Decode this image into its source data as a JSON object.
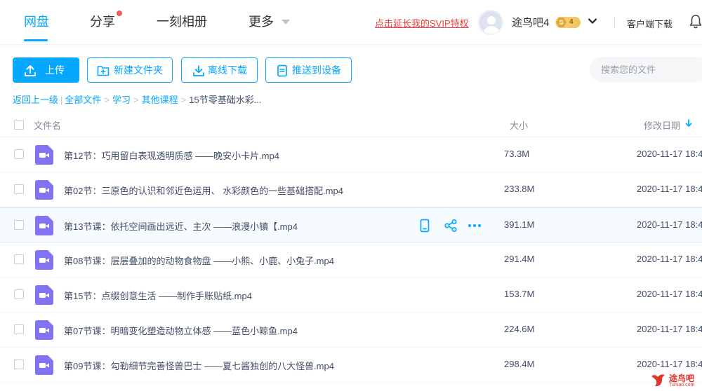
{
  "nav": {
    "tabs": [
      {
        "label": "网盘",
        "active": true
      },
      {
        "label": "分享",
        "badge_dot": true
      },
      {
        "label": "一刻相册"
      },
      {
        "label": "更多"
      }
    ],
    "promo_link": "点击延长我的SVIP特权",
    "username": "途鸟吧4",
    "vip_badge": {
      "tier": "S",
      "level": "4"
    },
    "client_download": "客户端下载"
  },
  "toolbar": {
    "upload": "上传",
    "new_folder": "新建文件夹",
    "offline_download": "离线下载",
    "push_to_device": "推送到设备",
    "search_placeholder": "搜索您的文件"
  },
  "breadcrumb": {
    "back": "返回上一级",
    "items": [
      "全部文件",
      "学习",
      "其他课程"
    ],
    "current": "15节零基础水彩..."
  },
  "table": {
    "headers": {
      "name": "文件名",
      "size": "大小",
      "modified": "修改日期"
    },
    "sort": {
      "column": "modified",
      "direction": "desc"
    },
    "rows": [
      {
        "name": "第12节：巧用留白表现透明质感 ——晚安小卡片.mp4",
        "size": "73.3M",
        "date": "2020-11-17 18:4"
      },
      {
        "name": "第02节：三原色的认识和邻近色运用、 水彩颜色的一些基础搭配.mp4",
        "size": "233.8M",
        "date": "2020-11-17 18:4"
      },
      {
        "name": "第13节课：依托空间画出远近、主次 ——浪漫小镇【.mp4",
        "size": "391.1M",
        "date": "2020-11-17 18:4",
        "hovered": true
      },
      {
        "name": "第08节课：层层叠加的的动物食物盘 ——小熊、小鹿、小兔子.mp4",
        "size": "291.4M",
        "date": "2020-11-17 18:4"
      },
      {
        "name": "第15节：点缀创意生活 ——制作手账贴纸.mp4",
        "size": "153.7M",
        "date": "2020-11-17 18:4"
      },
      {
        "name": "第07节课：明暗变化塑造动物立体感 ——蓝色小鲸鱼.mp4",
        "size": "224.6M",
        "date": "2020-11-17 18:4"
      },
      {
        "name": "第09节课：勾勒细节完善怪兽巴士 ——夏七酱独创的八大怪兽.mp4",
        "size": "298.4M",
        "date": "2020-11-17 18:4"
      }
    ],
    "file_icon": "video-file-icon",
    "row_actions": [
      "push-to-phone-icon",
      "share-icon",
      "more-icon"
    ]
  },
  "watermark": {
    "text": "途鸟吧",
    "url": "Tuniao.com"
  },
  "colors": {
    "accent": "#06a7ff",
    "promo": "#f23d3d",
    "video_icon": "#8174f2",
    "text": "#424e67"
  }
}
